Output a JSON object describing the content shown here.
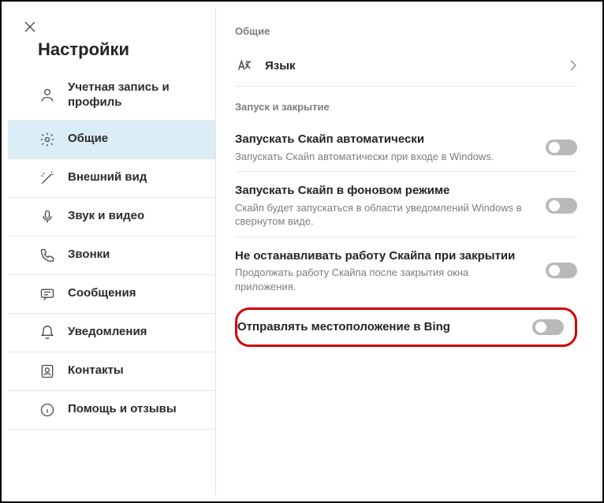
{
  "sidebar": {
    "title": "Настройки",
    "items": [
      {
        "label": "Учетная запись и профиль"
      },
      {
        "label": "Общие"
      },
      {
        "label": "Внешний вид"
      },
      {
        "label": "Звук и видео"
      },
      {
        "label": "Звонки"
      },
      {
        "label": "Сообщения"
      },
      {
        "label": "Уведомления"
      },
      {
        "label": "Контакты"
      },
      {
        "label": "Помощь и отзывы"
      }
    ]
  },
  "content": {
    "section_general": "Общие",
    "language_label": "Язык",
    "section_startup": "Запуск и закрытие",
    "rows": [
      {
        "title": "Запускать Скайп автоматически",
        "desc": "Запускать Скайп автоматически при входе в Windows."
      },
      {
        "title": "Запускать Скайп в фоновом режиме",
        "desc": "Скайп будет запускаться в области уведомлений Windows в свернутом виде."
      },
      {
        "title": "Не останавливать работу Скайпа при закрытии",
        "desc": "Продолжать работу Скайпа после закрытия окна приложения."
      }
    ],
    "highlight": {
      "title": "Отправлять место­положение в Bing"
    }
  }
}
